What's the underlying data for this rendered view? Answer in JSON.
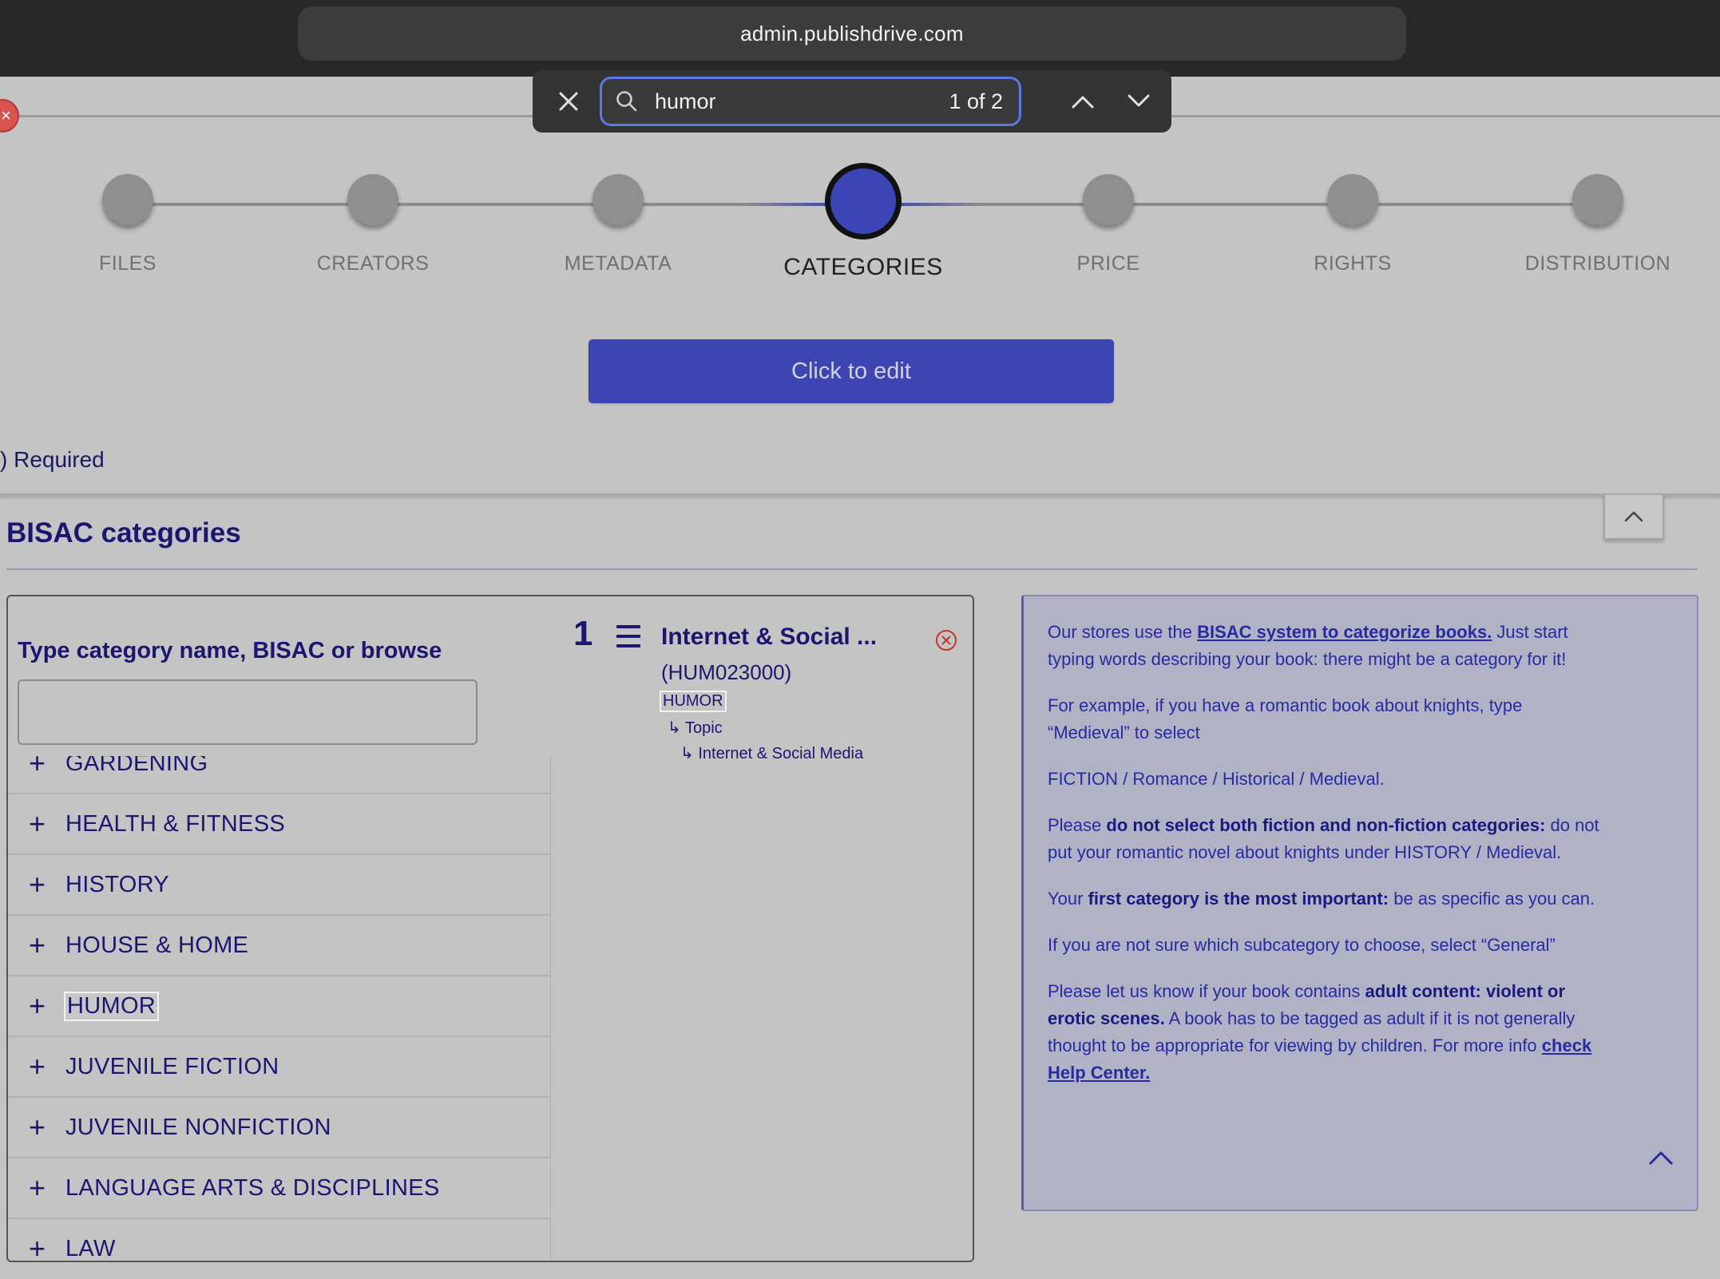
{
  "browser": {
    "url": "admin.publishdrive.com"
  },
  "find_bar": {
    "query": "humor",
    "match_count": "1 of 2"
  },
  "stepper": {
    "steps": [
      {
        "label": "FILES",
        "active": false
      },
      {
        "label": "CREATORS",
        "active": false
      },
      {
        "label": "METADATA",
        "active": false
      },
      {
        "label": "CATEGORIES",
        "active": true
      },
      {
        "label": "PRICE",
        "active": false
      },
      {
        "label": "RIGHTS",
        "active": false
      },
      {
        "label": "DISTRIBUTION",
        "active": false
      }
    ]
  },
  "edit_button": "Click to edit",
  "required_note": ") Required",
  "bisac": {
    "title": "BISAC categories",
    "search_label": "Type category name, BISAC or browse",
    "search_value": "",
    "list": [
      "GARDENING",
      "HEALTH & FITNESS",
      "HISTORY",
      "HOUSE & HOME",
      "HUMOR",
      "JUVENILE FICTION",
      "JUVENILE NONFICTION",
      "LANGUAGE ARTS & DISCIPLINES",
      "LAW"
    ],
    "highlighted": "HUMOR",
    "selected": {
      "index": "1",
      "title": "Internet & Social ...",
      "code": "(HUM023000)",
      "path": [
        "HUMOR",
        "Topic",
        "Internet & Social Media"
      ]
    }
  },
  "info": {
    "p1_before": "Our stores use the ",
    "p1_link": "BISAC system to categorize books.",
    "p1_after": " Just start typing words describing your book: there might be a category for it!",
    "p2": "For example, if you have a romantic book about knights, type “Medieval” to select",
    "p3": "FICTION / Romance / Historical / Medieval.",
    "p4_before": "Please ",
    "p4_bold": "do not select both fiction and non-fiction categories:",
    "p4_after": " do not put your romantic novel about knights under HISTORY / Medieval.",
    "p5_before": "Your ",
    "p5_bold": "first category is the most important:",
    "p5_after": " be as specific as you can.",
    "p6": "If you are not sure which subcategory to choose, select “General”",
    "p7_before": "Please let us know if your book contains ",
    "p7_bold1": "adult content: violent or erotic scenes.",
    "p7_mid": " A book has to be tagged as adult if it is not generally thought to be appropriate for viewing by children. For more info ",
    "p7_link": "check Help Center."
  },
  "colors": {
    "accent": "#3d45b2",
    "text_dark_blue": "#1c1670",
    "info_bg": "#b2b2c6",
    "chrome": "#282828"
  }
}
